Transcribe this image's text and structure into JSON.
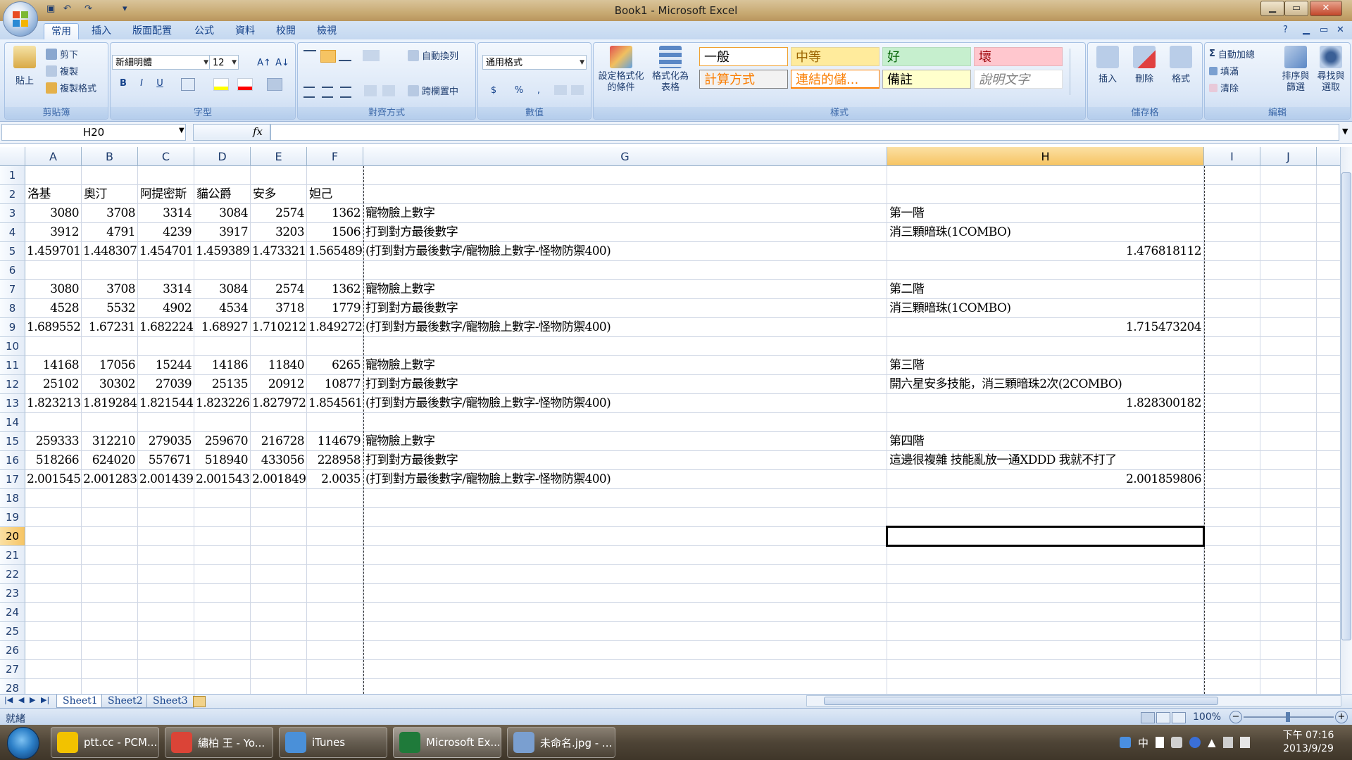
{
  "window": {
    "title": "Book1 - Microsoft Excel",
    "minimize": "▁",
    "maximize": "▭",
    "close": "✕"
  },
  "qat": {
    "save": "▣",
    "undo": "↶",
    "redo": "↷",
    "more": "▾"
  },
  "ribbon": {
    "tabs": [
      "常用",
      "插入",
      "版面配置",
      "公式",
      "資料",
      "校閱",
      "檢視"
    ],
    "help": "?",
    "clipboard": {
      "label": "剪貼簿",
      "paste": "貼上",
      "cut": "剪下",
      "copy": "複製",
      "format_painter": "複製格式"
    },
    "font": {
      "label": "字型",
      "name": "新細明體",
      "size": "12",
      "bold": "B",
      "italic": "I",
      "underline": "U",
      "grow": "A↑",
      "shrink": "A↓"
    },
    "alignment": {
      "label": "對齊方式",
      "wrap": "自動換列",
      "merge": "跨欄置中"
    },
    "number": {
      "label": "數值",
      "format": "通用格式",
      "currency": "$",
      "percent": "%",
      "comma": ","
    },
    "styles": {
      "label": "樣式",
      "conditional": "設定格式化的條件",
      "as_table": "格式化為表格",
      "cells": [
        {
          "text": "一般",
          "bg": "#ffffff",
          "color": "#000000",
          "border": "#f0a030"
        },
        {
          "text": "中等",
          "bg": "#ffeb9c",
          "color": "#9c6500",
          "border": "#e6d59a"
        },
        {
          "text": "好",
          "bg": "#c6efce",
          "color": "#006100",
          "border": "#b4dcbc"
        },
        {
          "text": "壞",
          "bg": "#ffc7ce",
          "color": "#9c0006",
          "border": "#e8b3ba"
        },
        {
          "text": "計算方式",
          "bg": "#f2f2f2",
          "color": "#fa7d00",
          "border": "#7f7f7f"
        },
        {
          "text": "連結的儲...",
          "bg": "#ffffff",
          "color": "#fa7d00",
          "border": "#ff8001"
        },
        {
          "text": "備註",
          "bg": "#ffffcc",
          "color": "#000000",
          "border": "#b2b2b2"
        },
        {
          "text": "說明文字",
          "bg": "#ffffff",
          "color": "#7f7f7f",
          "border": "#e0e0e0"
        }
      ]
    },
    "cells_group": {
      "label": "儲存格",
      "insert": "插入",
      "delete": "刪除",
      "format": "格式"
    },
    "editing": {
      "label": "編輯",
      "autosum": "自動加總",
      "fill": "填滿",
      "clear": "清除",
      "sort": "排序與篩選",
      "find": "尋找與選取"
    }
  },
  "formula_bar": {
    "name_box": "H20",
    "fx": "fx",
    "value": ""
  },
  "columns": [
    "A",
    "B",
    "C",
    "D",
    "E",
    "F",
    "G",
    "H",
    "I",
    "J"
  ],
  "selected_column": "H",
  "rows": [
    "1",
    "2",
    "3",
    "4",
    "5",
    "6",
    "7",
    "8",
    "9",
    "10",
    "11",
    "12",
    "13",
    "14",
    "15",
    "16",
    "17",
    "18",
    "19",
    "20",
    "21",
    "22",
    "23",
    "24",
    "25",
    "26",
    "27",
    "28"
  ],
  "selected_row": "20",
  "sheet": [
    {
      "row": 2,
      "col": "A",
      "v": "洛基"
    },
    {
      "row": 2,
      "col": "B",
      "v": "奧汀"
    },
    {
      "row": 2,
      "col": "C",
      "v": "阿提密斯"
    },
    {
      "row": 2,
      "col": "D",
      "v": "貓公爵"
    },
    {
      "row": 2,
      "col": "E",
      "v": "安多"
    },
    {
      "row": 2,
      "col": "F",
      "v": "妲己"
    },
    {
      "row": 3,
      "col": "A",
      "v": "3080",
      "n": true
    },
    {
      "row": 3,
      "col": "B",
      "v": "3708",
      "n": true
    },
    {
      "row": 3,
      "col": "C",
      "v": "3314",
      "n": true
    },
    {
      "row": 3,
      "col": "D",
      "v": "3084",
      "n": true
    },
    {
      "row": 3,
      "col": "E",
      "v": "2574",
      "n": true
    },
    {
      "row": 3,
      "col": "F",
      "v": "1362",
      "n": true
    },
    {
      "row": 3,
      "col": "G",
      "v": "寵物臉上數字"
    },
    {
      "row": 3,
      "col": "H",
      "v": "第一階"
    },
    {
      "row": 4,
      "col": "A",
      "v": "3912",
      "n": true
    },
    {
      "row": 4,
      "col": "B",
      "v": "4791",
      "n": true
    },
    {
      "row": 4,
      "col": "C",
      "v": "4239",
      "n": true
    },
    {
      "row": 4,
      "col": "D",
      "v": "3917",
      "n": true
    },
    {
      "row": 4,
      "col": "E",
      "v": "3203",
      "n": true
    },
    {
      "row": 4,
      "col": "F",
      "v": "1506",
      "n": true
    },
    {
      "row": 4,
      "col": "G",
      "v": "打到對方最後數字"
    },
    {
      "row": 4,
      "col": "H",
      "v": "消三顆暗珠(1COMBO)"
    },
    {
      "row": 5,
      "col": "A",
      "v": "1.459701",
      "n": true
    },
    {
      "row": 5,
      "col": "B",
      "v": "1.448307",
      "n": true
    },
    {
      "row": 5,
      "col": "C",
      "v": "1.454701",
      "n": true
    },
    {
      "row": 5,
      "col": "D",
      "v": "1.459389",
      "n": true
    },
    {
      "row": 5,
      "col": "E",
      "v": "1.473321",
      "n": true
    },
    {
      "row": 5,
      "col": "F",
      "v": "1.565489",
      "n": true
    },
    {
      "row": 5,
      "col": "G",
      "v": "(打到對方最後數字/寵物臉上數字-怪物防禦400)"
    },
    {
      "row": 5,
      "col": "H",
      "v": "1.476818112",
      "n": true
    },
    {
      "row": 7,
      "col": "A",
      "v": "3080",
      "n": true
    },
    {
      "row": 7,
      "col": "B",
      "v": "3708",
      "n": true
    },
    {
      "row": 7,
      "col": "C",
      "v": "3314",
      "n": true
    },
    {
      "row": 7,
      "col": "D",
      "v": "3084",
      "n": true
    },
    {
      "row": 7,
      "col": "E",
      "v": "2574",
      "n": true
    },
    {
      "row": 7,
      "col": "F",
      "v": "1362",
      "n": true
    },
    {
      "row": 7,
      "col": "G",
      "v": "寵物臉上數字"
    },
    {
      "row": 7,
      "col": "H",
      "v": "第二階"
    },
    {
      "row": 8,
      "col": "A",
      "v": "4528",
      "n": true
    },
    {
      "row": 8,
      "col": "B",
      "v": "5532",
      "n": true
    },
    {
      "row": 8,
      "col": "C",
      "v": "4902",
      "n": true
    },
    {
      "row": 8,
      "col": "D",
      "v": "4534",
      "n": true
    },
    {
      "row": 8,
      "col": "E",
      "v": "3718",
      "n": true
    },
    {
      "row": 8,
      "col": "F",
      "v": "1779",
      "n": true
    },
    {
      "row": 8,
      "col": "G",
      "v": "打到對方最後數字"
    },
    {
      "row": 8,
      "col": "H",
      "v": "消三顆暗珠(1COMBO)"
    },
    {
      "row": 9,
      "col": "A",
      "v": "1.689552",
      "n": true
    },
    {
      "row": 9,
      "col": "B",
      "v": "1.67231",
      "n": true
    },
    {
      "row": 9,
      "col": "C",
      "v": "1.682224",
      "n": true
    },
    {
      "row": 9,
      "col": "D",
      "v": "1.68927",
      "n": true
    },
    {
      "row": 9,
      "col": "E",
      "v": "1.710212",
      "n": true
    },
    {
      "row": 9,
      "col": "F",
      "v": "1.849272",
      "n": true
    },
    {
      "row": 9,
      "col": "G",
      "v": "(打到對方最後數字/寵物臉上數字-怪物防禦400)"
    },
    {
      "row": 9,
      "col": "H",
      "v": "1.715473204",
      "n": true
    },
    {
      "row": 11,
      "col": "A",
      "v": "14168",
      "n": true
    },
    {
      "row": 11,
      "col": "B",
      "v": "17056",
      "n": true
    },
    {
      "row": 11,
      "col": "C",
      "v": "15244",
      "n": true
    },
    {
      "row": 11,
      "col": "D",
      "v": "14186",
      "n": true
    },
    {
      "row": 11,
      "col": "E",
      "v": "11840",
      "n": true
    },
    {
      "row": 11,
      "col": "F",
      "v": "6265",
      "n": true
    },
    {
      "row": 11,
      "col": "G",
      "v": "寵物臉上數字"
    },
    {
      "row": 11,
      "col": "H",
      "v": "第三階"
    },
    {
      "row": 12,
      "col": "A",
      "v": "25102",
      "n": true
    },
    {
      "row": 12,
      "col": "B",
      "v": "30302",
      "n": true
    },
    {
      "row": 12,
      "col": "C",
      "v": "27039",
      "n": true
    },
    {
      "row": 12,
      "col": "D",
      "v": "25135",
      "n": true
    },
    {
      "row": 12,
      "col": "E",
      "v": "20912",
      "n": true
    },
    {
      "row": 12,
      "col": "F",
      "v": "10877",
      "n": true
    },
    {
      "row": 12,
      "col": "G",
      "v": "打到對方最後數字"
    },
    {
      "row": 12,
      "col": "H",
      "v": "開六星安多技能，消三顆暗珠2次(2COMBO)"
    },
    {
      "row": 13,
      "col": "A",
      "v": "1.823213",
      "n": true
    },
    {
      "row": 13,
      "col": "B",
      "v": "1.819284",
      "n": true
    },
    {
      "row": 13,
      "col": "C",
      "v": "1.821544",
      "n": true
    },
    {
      "row": 13,
      "col": "D",
      "v": "1.823226",
      "n": true
    },
    {
      "row": 13,
      "col": "E",
      "v": "1.827972",
      "n": true
    },
    {
      "row": 13,
      "col": "F",
      "v": "1.854561",
      "n": true
    },
    {
      "row": 13,
      "col": "G",
      "v": "(打到對方最後數字/寵物臉上數字-怪物防禦400)"
    },
    {
      "row": 13,
      "col": "H",
      "v": "1.828300182",
      "n": true
    },
    {
      "row": 15,
      "col": "A",
      "v": "259333",
      "n": true
    },
    {
      "row": 15,
      "col": "B",
      "v": "312210",
      "n": true
    },
    {
      "row": 15,
      "col": "C",
      "v": "279035",
      "n": true
    },
    {
      "row": 15,
      "col": "D",
      "v": "259670",
      "n": true
    },
    {
      "row": 15,
      "col": "E",
      "v": "216728",
      "n": true
    },
    {
      "row": 15,
      "col": "F",
      "v": "114679",
      "n": true
    },
    {
      "row": 15,
      "col": "G",
      "v": "寵物臉上數字"
    },
    {
      "row": 15,
      "col": "H",
      "v": "第四階"
    },
    {
      "row": 16,
      "col": "A",
      "v": "518266",
      "n": true
    },
    {
      "row": 16,
      "col": "B",
      "v": "624020",
      "n": true
    },
    {
      "row": 16,
      "col": "C",
      "v": "557671",
      "n": true
    },
    {
      "row": 16,
      "col": "D",
      "v": "518940",
      "n": true
    },
    {
      "row": 16,
      "col": "E",
      "v": "433056",
      "n": true
    },
    {
      "row": 16,
      "col": "F",
      "v": "228958",
      "n": true
    },
    {
      "row": 16,
      "col": "G",
      "v": "打到對方最後數字"
    },
    {
      "row": 16,
      "col": "H",
      "v": "這邊很複雜 技能亂放一通XDDD 我就不打了"
    },
    {
      "row": 17,
      "col": "A",
      "v": "2.001545",
      "n": true
    },
    {
      "row": 17,
      "col": "B",
      "v": "2.001283",
      "n": true
    },
    {
      "row": 17,
      "col": "C",
      "v": "2.001439",
      "n": true
    },
    {
      "row": 17,
      "col": "D",
      "v": "2.001543",
      "n": true
    },
    {
      "row": 17,
      "col": "E",
      "v": "2.001849",
      "n": true
    },
    {
      "row": 17,
      "col": "F",
      "v": "2.0035",
      "n": true
    },
    {
      "row": 17,
      "col": "G",
      "v": "(打到對方最後數字/寵物臉上數字-怪物防禦400)"
    },
    {
      "row": 17,
      "col": "H",
      "v": "2.001859806",
      "n": true
    }
  ],
  "sheet_tabs": [
    "Sheet1",
    "Sheet2",
    "Sheet3"
  ],
  "active_sheet": "Sheet1",
  "status": {
    "ready": "就緒",
    "zoom": "100%"
  },
  "taskbar": {
    "tasks": [
      {
        "label": "ptt.cc - PCM...",
        "color": "#f2c200"
      },
      {
        "label": "繡柏 王 - Yo...",
        "color": "#db4437"
      },
      {
        "label": "iTunes",
        "color": "#4a90d9"
      },
      {
        "label": "Microsoft Ex...",
        "color": "#1f7a3a"
      },
      {
        "label": "未命名.jpg - ...",
        "color": "#7a9fd0"
      }
    ],
    "active_task": 3,
    "tray_ime": "中",
    "clock_time": "下午 07:16",
    "clock_date": "2013/9/29"
  }
}
